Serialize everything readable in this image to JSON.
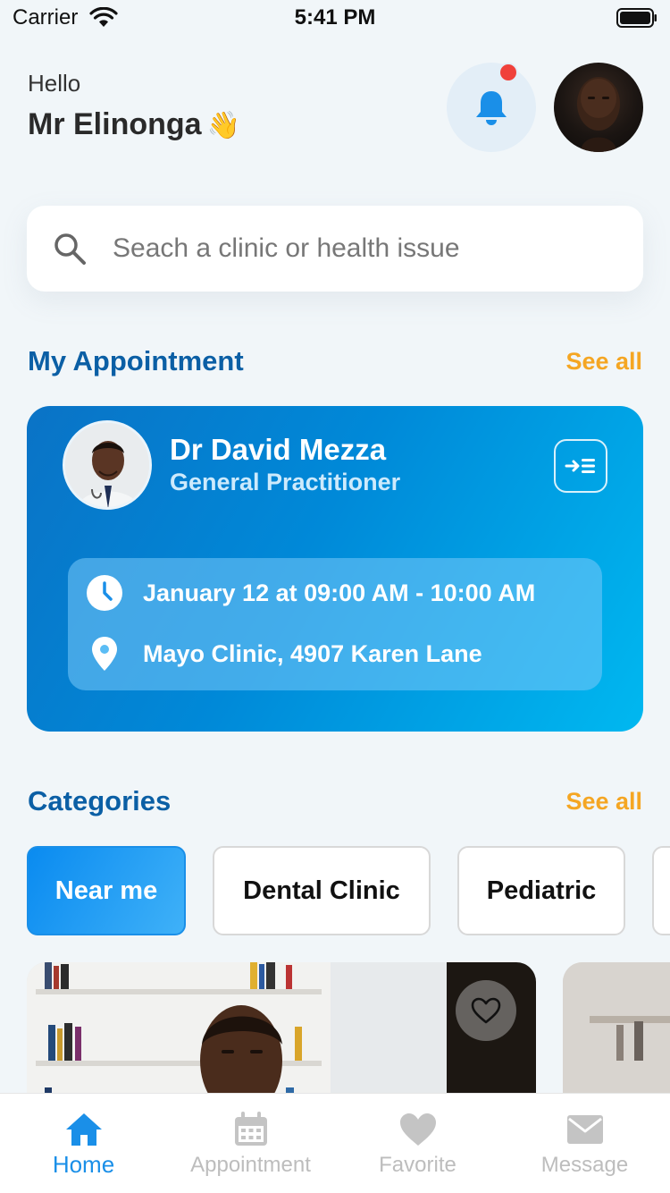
{
  "status_bar": {
    "carrier": "Carrier",
    "time": "5:41 PM"
  },
  "header": {
    "greeting": "Hello",
    "user_name": "Mr Elinonga",
    "wave_emoji": "👋",
    "notification_badge": true
  },
  "search": {
    "placeholder": "Seach a clinic or health issue"
  },
  "appointments": {
    "title": "My Appointment",
    "see_all": "See all",
    "card": {
      "doctor_name": "Dr David Mezza",
      "specialty": "General Practitioner",
      "datetime": "January 12 at 09:00 AM - 10:00 AM",
      "location": "Mayo Clinic, 4907 Karen Lane"
    }
  },
  "categories": {
    "title": "Categories",
    "see_all": "See all",
    "items": [
      {
        "label": "Near me",
        "active": true
      },
      {
        "label": "Dental Clinic",
        "active": false
      },
      {
        "label": "Pediatric",
        "active": false
      }
    ]
  },
  "tab_bar": {
    "items": [
      {
        "label": "Home",
        "icon": "home-icon",
        "active": true
      },
      {
        "label": "Appointment",
        "icon": "calendar-icon",
        "active": false
      },
      {
        "label": "Favorite",
        "icon": "heart-icon",
        "active": false
      },
      {
        "label": "Message",
        "icon": "mail-icon",
        "active": false
      }
    ]
  },
  "colors": {
    "brand": "#0b5fa5",
    "accent": "#f5a623",
    "active_tab": "#1a8fe8"
  }
}
